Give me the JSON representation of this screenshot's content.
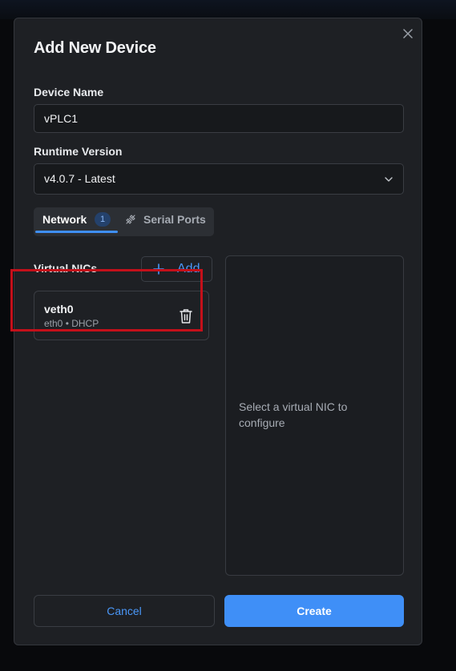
{
  "dialog": {
    "title": "Add New Device",
    "close_icon": "close-icon"
  },
  "device_name": {
    "label": "Device Name",
    "value": "vPLC1"
  },
  "runtime_version": {
    "label": "Runtime Version",
    "selected": "v4.0.7 - Latest",
    "icon": "chevron-down-icon"
  },
  "tabs": [
    {
      "label": "Network",
      "badge": "1",
      "active": true
    },
    {
      "label": "Serial Ports",
      "icon": "serial-port-icon",
      "active": false
    }
  ],
  "virtual_nics": {
    "label": "Virtual NICs",
    "add_label": "Add",
    "items": [
      {
        "name": "veth0",
        "detail": "eth0 • DHCP"
      }
    ]
  },
  "config_panel": {
    "placeholder": "Select a virtual NIC to configure"
  },
  "footer": {
    "cancel_label": "Cancel",
    "create_label": "Create"
  },
  "colors": {
    "accent": "#3f8ff7",
    "highlight": "#c4101a",
    "background": "#1e2024"
  }
}
